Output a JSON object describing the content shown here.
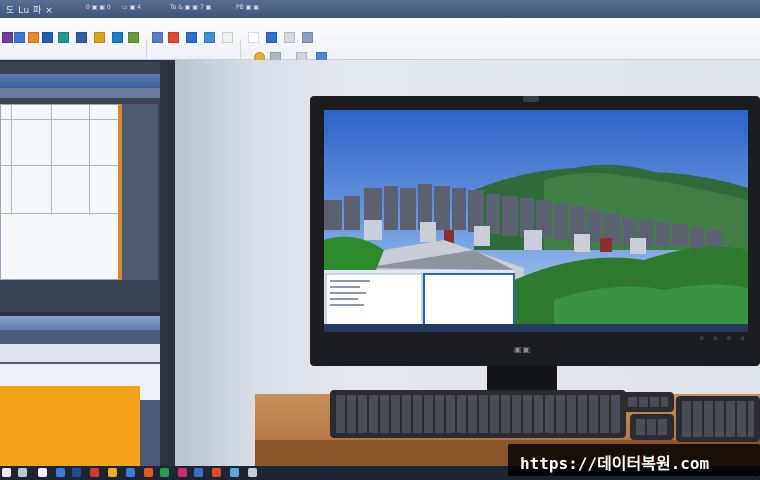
{
  "window": {
    "title": "도 Lu 파 ×",
    "toolbar_groups": [
      "0  ▣  ▣  0",
      "▭  ▣  4",
      "To & ▣ ▣ 7 ▣",
      "PB  ▣  ▣"
    ]
  },
  "monitor": {
    "brand": "▣▣",
    "buttons": "o o o o"
  },
  "watermark": {
    "text": "https://데이터복원.com"
  },
  "colors": {
    "sky_top": "#2f66c9",
    "mountain": "#2f6b3a",
    "watermark_bg": "#000000",
    "ribbon_bg": "#f3f5f9",
    "desk": "#b67a44",
    "orange_panel": "#f5a21b"
  },
  "icons": [
    "monitor-icon",
    "keyboard-icon",
    "city-render-icon",
    "taskbar-app-icon"
  ]
}
